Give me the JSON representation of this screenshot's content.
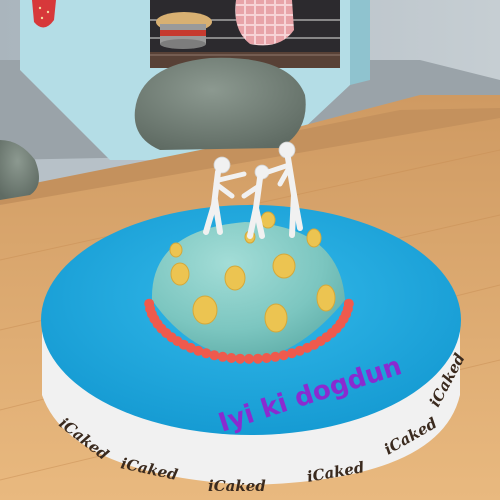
{
  "cake": {
    "message": "Iyi ki dogdun",
    "board_brand": [
      "iCaked",
      "iCaked",
      "iCaked",
      "iCaked",
      "iCaked",
      "iCaked"
    ]
  },
  "colors": {
    "board": "#1aa8df",
    "board_rim": "#f2f2f2",
    "dome": "#7fc9c3",
    "dots": "#ecc451",
    "beads": "#ef5a4d",
    "message": "#8a2bd0",
    "table": "#dca56a"
  }
}
